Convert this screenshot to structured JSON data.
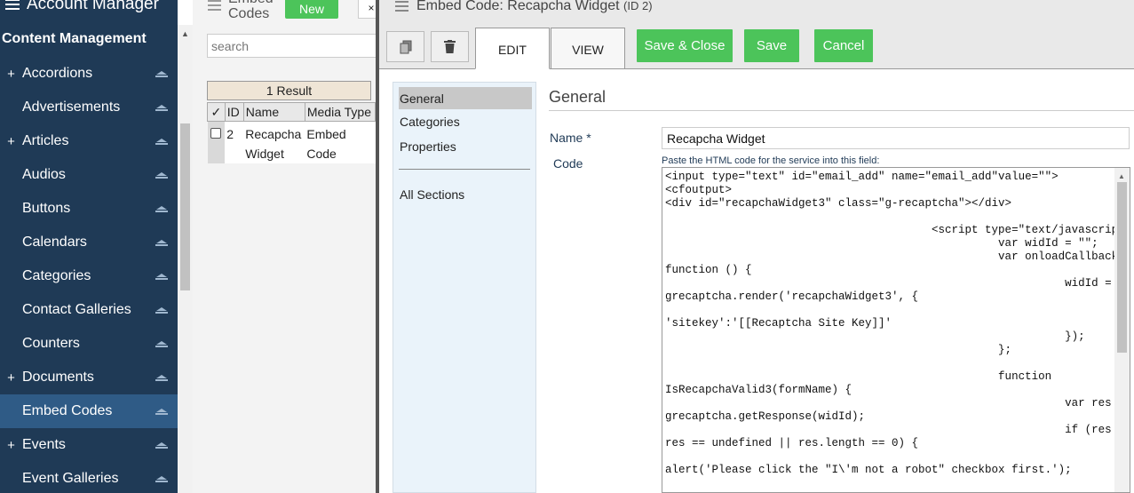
{
  "sidebar": {
    "app_title": "Account Manager",
    "section_title": "Content Management",
    "items": [
      {
        "label": "Accordions",
        "expandable": true
      },
      {
        "label": "Advertisements",
        "expandable": false
      },
      {
        "label": "Articles",
        "expandable": true
      },
      {
        "label": "Audios",
        "expandable": false
      },
      {
        "label": "Buttons",
        "expandable": false
      },
      {
        "label": "Calendars",
        "expandable": false
      },
      {
        "label": "Categories",
        "expandable": false
      },
      {
        "label": "Contact Galleries",
        "expandable": false
      },
      {
        "label": "Counters",
        "expandable": false
      },
      {
        "label": "Documents",
        "expandable": true
      },
      {
        "label": "Embed Codes",
        "expandable": false,
        "active": true
      },
      {
        "label": "Events",
        "expandable": true
      },
      {
        "label": "Event Galleries",
        "expandable": false
      }
    ],
    "plus_glyph": "+",
    "colors": {
      "background": "#1f3a56",
      "active": "#2f5b86"
    }
  },
  "list_panel": {
    "title": "Embed Codes",
    "new_label": "New",
    "close_glyph": "×",
    "search_placeholder": "search",
    "result_count": "1 Result",
    "columns": [
      "✓",
      "ID",
      "Name",
      "Media Type"
    ],
    "rows": [
      {
        "id": "2",
        "name": "Recapcha Widget",
        "media_type": "Embed Code"
      }
    ]
  },
  "editor": {
    "title": "Embed Code: Recapcha Widget",
    "id_label": "(ID 2)",
    "tabs": [
      "EDIT",
      "VIEW"
    ],
    "active_tab": "EDIT",
    "buttons": {
      "save_close": "Save & Close",
      "save": "Save",
      "cancel": "Cancel"
    },
    "sections": [
      "General",
      "Categories",
      "Properties",
      "All Sections"
    ],
    "active_section": "General",
    "form_title": "General",
    "name_label": "Name *",
    "name_value": "Recapcha Widget",
    "code_label": "Code",
    "code_hint": "Paste the HTML code for the service into this field:",
    "code_value": "<input type=\"text\" id=\"email_add\" name=\"email_add\"value=\"\">\n<cfoutput>\n<div id=\"recapchaWidget3\" class=\"g-recaptcha\"></div>\n\n                                        <script type=\"text/javascript\">\n                                                  var widId = \"\";\n                                                  var onloadCallback =\nfunction () {\n                                                            widId =\ngrecaptcha.render('recapchaWidget3', {\n\n'sitekey':'[[Recaptcha Site Key]]'\n                                                            });\n                                                  };\n\n                                                  function\nIsRecapchaValid3(formName) {\n                                                            var res =\ngrecaptcha.getResponse(widId);\n                                                            if (res == '' ||\nres == undefined || res.length == 0) {\n\nalert('Please click the \"I\\'m not a robot\" checkbox first.');\n                                                                      return",
    "accent_green": "#4cc45a"
  }
}
